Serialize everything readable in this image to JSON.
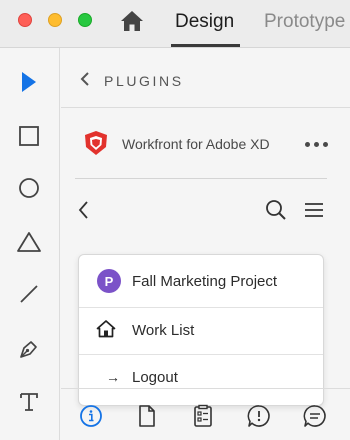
{
  "window": {
    "tabs": [
      {
        "label": "Design",
        "active": true
      },
      {
        "label": "Prototype",
        "active": false
      }
    ]
  },
  "toolbar": {
    "tools": [
      "select-arrow-icon",
      "rectangle-icon",
      "ellipse-icon",
      "triangle-icon",
      "line-icon",
      "pen-icon",
      "text-icon"
    ],
    "accent_color": "#1473e6"
  },
  "plugins_panel": {
    "title": "PLUGINS",
    "plugin_name": "Workfront for Adobe XD"
  },
  "workfront_menu": {
    "items": [
      {
        "label": "Fall Marketing Project",
        "avatar_letter": "P",
        "icon": "project-avatar",
        "color": "#7b52c8"
      },
      {
        "label": "Work List",
        "icon": "home-icon"
      },
      {
        "label": "Logout",
        "icon": "arrow-right-icon",
        "arrow": "→"
      }
    ]
  },
  "bottom_bar": {
    "icons": [
      "info-icon",
      "document-icon",
      "checklist-icon",
      "alert-bubble-icon",
      "chat-icon"
    ],
    "active_color": "#1473e6"
  }
}
